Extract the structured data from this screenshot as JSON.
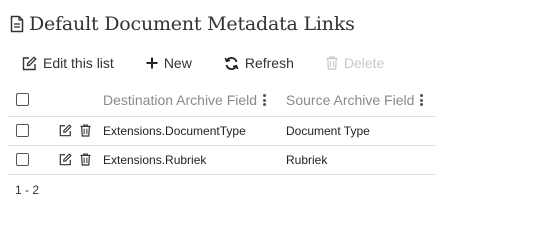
{
  "page": {
    "title": "Default Document Metadata Links",
    "title_icon": "document-icon"
  },
  "toolbar": {
    "edit_label": "Edit this list",
    "new_label": "New",
    "refresh_label": "Refresh",
    "delete_label": "Delete"
  },
  "table": {
    "columns": [
      "Destination Archive Field",
      "Source Archive Field"
    ],
    "rows": [
      {
        "destination": "Extensions.DocumentType",
        "source": "Document Type"
      },
      {
        "destination": "Extensions.Rubriek",
        "source": "Rubriek"
      }
    ]
  },
  "pager": {
    "range": "1 - 2"
  },
  "colors": {
    "text": "#333333",
    "header_text": "#8a8a8a",
    "disabled": "#c8c8c8",
    "divider": "#e2e2e2"
  }
}
